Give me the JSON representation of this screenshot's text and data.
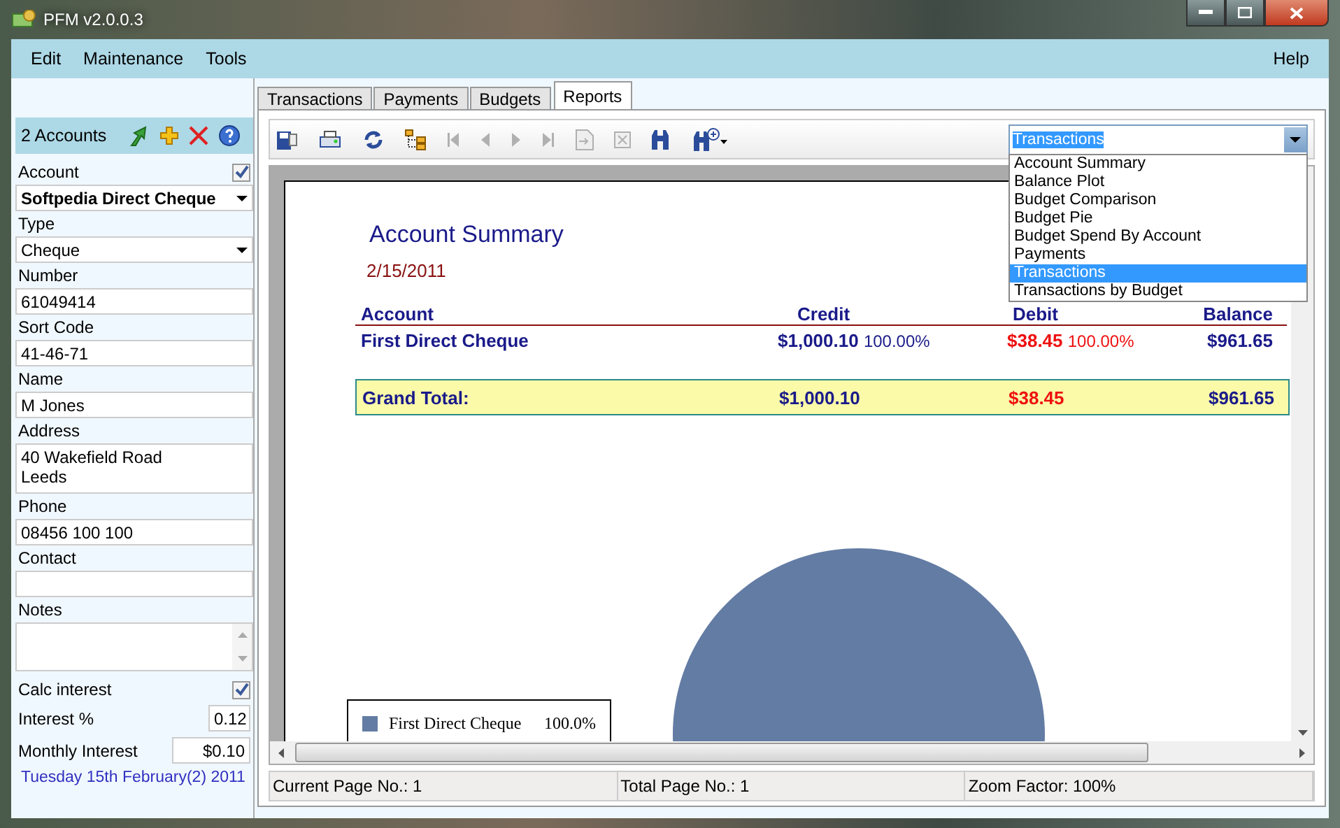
{
  "window": {
    "title": "PFM v2.0.0.3"
  },
  "menu": {
    "left": [
      "Edit",
      "Maintenance",
      "Tools"
    ],
    "right": [
      "Help"
    ]
  },
  "sidebar": {
    "header": "2 Accounts",
    "account": {
      "label": "Account",
      "checked": true,
      "value": "Softpedia Direct Cheque"
    },
    "fields": [
      {
        "label": "Type",
        "kind": "combo",
        "value": "Cheque"
      },
      {
        "label": "Number",
        "kind": "text",
        "value": "61049414"
      },
      {
        "label": "Sort Code",
        "kind": "text",
        "value": "41-46-71"
      },
      {
        "label": "Name",
        "kind": "text",
        "value": "M Jones"
      },
      {
        "label": "Address",
        "kind": "multiline",
        "lines": [
          "40 Wakefield Road",
          "Leeds"
        ]
      },
      {
        "label": "Phone",
        "kind": "text",
        "value": "08456 100 100"
      },
      {
        "label": "Contact",
        "kind": "text"
      },
      {
        "label": "Notes",
        "kind": "notes"
      }
    ],
    "calc_interest": {
      "label": "Calc interest",
      "checked": true
    },
    "interest": {
      "label": "Interest %",
      "value": "0.12"
    },
    "monthly_interest": {
      "label": "Monthly Interest",
      "value": "$0.10"
    },
    "date": "Tuesday 15th February(2) 2011"
  },
  "tabs": [
    {
      "label": "Transactions",
      "selected": false
    },
    {
      "label": "Payments",
      "selected": false
    },
    {
      "label": "Budgets",
      "selected": false
    },
    {
      "label": "Reports",
      "selected": true
    }
  ],
  "toolbar": [
    {
      "kind": "save",
      "disabled": false
    },
    {
      "kind": "print",
      "disabled": false
    },
    {
      "kind": "refresh",
      "disabled": false
    },
    {
      "kind": "tree",
      "disabled": false
    },
    {
      "kind": "first",
      "disabled": true
    },
    {
      "kind": "prev",
      "disabled": true
    },
    {
      "kind": "next",
      "disabled": true
    },
    {
      "kind": "last",
      "disabled": true
    },
    {
      "kind": "export",
      "disabled": true
    },
    {
      "kind": "stop",
      "disabled": true
    },
    {
      "kind": "find",
      "disabled": false
    },
    {
      "kind": "zoom",
      "disabled": false
    }
  ],
  "report_selector": {
    "value": "Transactions",
    "expanded": true,
    "options": [
      {
        "label": "Account Summary",
        "selected": false
      },
      {
        "label": "Balance Plot",
        "selected": false
      },
      {
        "label": "Budget Comparison",
        "selected": false
      },
      {
        "label": "Budget Pie",
        "selected": false
      },
      {
        "label": "Budget Spend By Account",
        "selected": false
      },
      {
        "label": "Payments",
        "selected": false
      },
      {
        "label": "Transactions",
        "selected": true
      },
      {
        "label": "Transactions by Budget",
        "selected": false
      }
    ]
  },
  "report": {
    "title": "Account Summary",
    "date": "2/15/2011",
    "columns": [
      "Account",
      "Credit",
      "Debit",
      "Balance"
    ],
    "rows": [
      {
        "account": "First Direct Cheque",
        "credit": "$1,000.10",
        "credit_pct": "100.00%",
        "debit": "$38.45",
        "debit_pct": "100.00%",
        "balance": "$961.65"
      }
    ],
    "total": {
      "label": "Grand Total:",
      "credit": "$1,000.10",
      "debit": "$38.45",
      "balance": "$961.65"
    },
    "chart_data": {
      "type": "pie",
      "categories": [
        "First Direct Cheque"
      ],
      "values": [
        100
      ],
      "value_labels": [
        "100.0%"
      ]
    }
  },
  "status_bar": [
    "Current Page No.: 1",
    "Total Page No.: 1",
    "Zoom Factor: 100%"
  ]
}
